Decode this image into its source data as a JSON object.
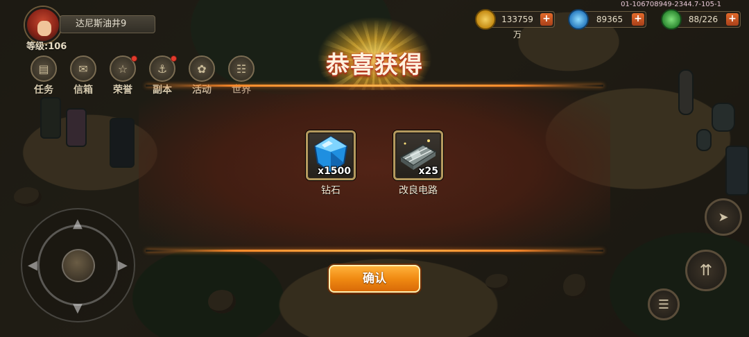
{
  "build_id": "01-106708949-2344.7-105-1",
  "player": {
    "name": "达尼斯油井9",
    "level_label": "等级:106"
  },
  "menu": [
    {
      "label": "任务",
      "icon": "task-icon",
      "badge": false
    },
    {
      "label": "信箱",
      "icon": "mailbox-icon",
      "badge": false
    },
    {
      "label": "荣誉",
      "icon": "honor-icon",
      "badge": true
    },
    {
      "label": "副本",
      "icon": "dungeon-icon",
      "badge": true
    },
    {
      "label": "活动",
      "icon": "event-icon",
      "badge": false
    },
    {
      "label": "世界",
      "icon": "globe-icon",
      "badge": false
    }
  ],
  "resources": {
    "gold": {
      "value": "133759万",
      "icon": "gold-coin-icon",
      "color": "#d9a520"
    },
    "crystal": {
      "value": "89365",
      "icon": "crystal-icon",
      "color": "#3aa8e8"
    },
    "energy": {
      "value": "88/226",
      "icon": "energy-leaf-icon",
      "color": "#3dbb4a"
    },
    "plus": "+"
  },
  "reward": {
    "title": "恭喜获得",
    "items": [
      {
        "name": "钻石",
        "count": "x1500",
        "icon": "diamond-icon"
      },
      {
        "name": "改良电路",
        "count": "x25",
        "icon": "circuit-board-icon"
      }
    ],
    "confirm_label": "确认"
  },
  "colors": {
    "panel": "#5a2416",
    "accent_line": "#ff8a2a",
    "confirm_button": "#f08a12",
    "title_glow": "#ffd84a"
  }
}
